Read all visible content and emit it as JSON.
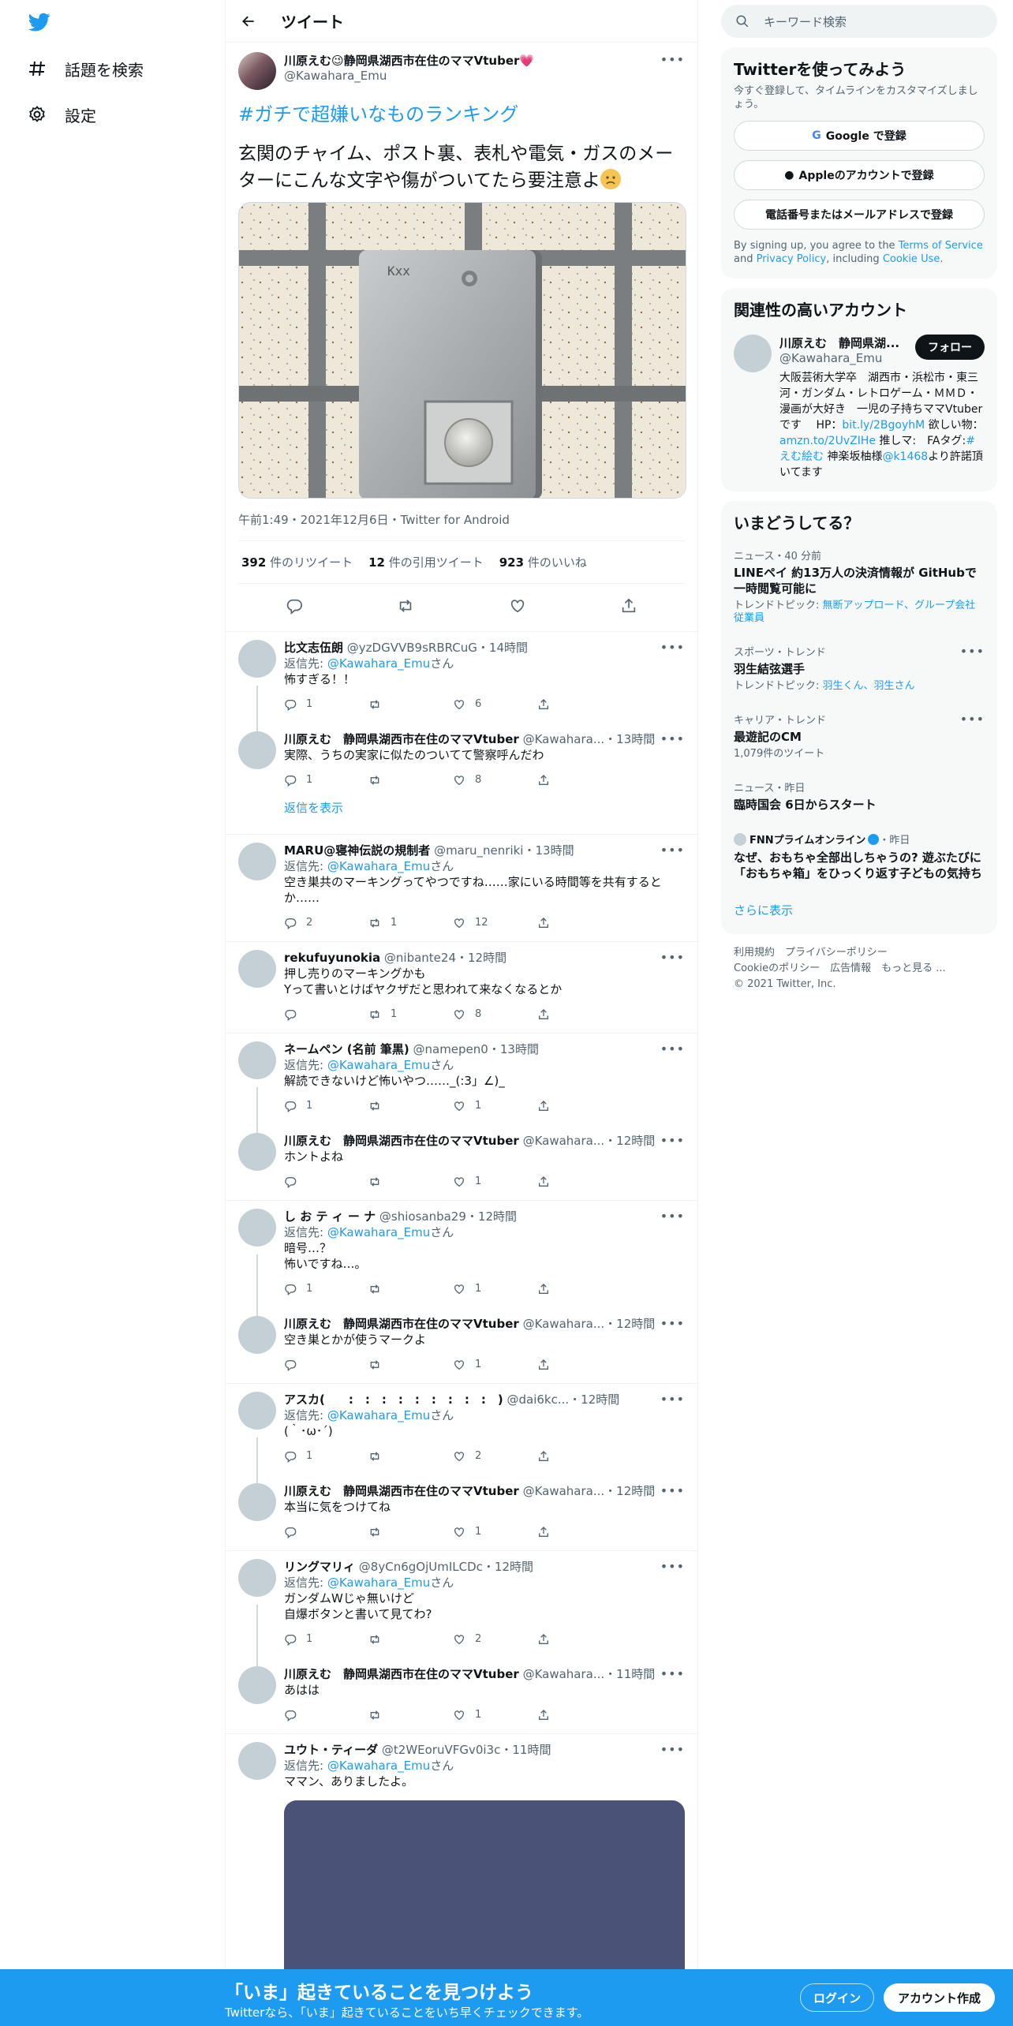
{
  "nav": {
    "explore_label": "話題を検索",
    "settings_label": "設定"
  },
  "header": {
    "title": "ツイート"
  },
  "focal": {
    "author_name": "川原えむ😉静岡県湖西市在住のママVtuber💗",
    "author_handle": "@Kawahara_Emu",
    "hashtag": "#ガチで超嫌いなものランキング",
    "text": "玄関のチャイム、ポスト裏、表札や電気・ガスのメーターにこんな文字や傷がついてたら要注意よ",
    "meta": "午前1:49・2021年12月6日・Twitter for Android",
    "image_text": "Kxx",
    "retweets": "392",
    "retweets_label": " 件のリツイート",
    "quotes": "12",
    "quotes_label": " 件の引用ツイート",
    "likes": "923",
    "likes_label": " 件のいいね"
  },
  "replies": [
    {
      "name": "比文志伍朗",
      "handle": "@yzDGVVB9sRBRCuG",
      "time": "14時間",
      "reply_to": "@Kawahara_Emu",
      "text": "怖すぎる！！",
      "replies": "1",
      "retweets": "",
      "likes": "6"
    },
    {
      "name": "川原えむ　静岡県湖西市在住のママVtuber",
      "handle": "@Kawahara...",
      "time": "13時間",
      "reply_to": "",
      "text": "実際、うちの実家に似たのついてて警察呼んだわ",
      "replies": "1",
      "retweets": "",
      "likes": "8"
    },
    {
      "name": "MARU@寝神伝説の規制者",
      "handle": "@maru_nenriki",
      "time": "13時間",
      "reply_to": "@Kawahara_Emu",
      "text": "空き巣共のマーキングってやつですね……家にいる時間等を共有するとか……",
      "replies": "2",
      "retweets": "1",
      "likes": "12"
    },
    {
      "name": "rekufuyunokia",
      "handle": "@nibante24",
      "time": "12時間",
      "reply_to": "",
      "text": "押し売りのマーキングかも\nYって書いとけばヤクザだと思われて来なくなるとか",
      "replies": "",
      "retweets": "1",
      "likes": "8"
    },
    {
      "name": "ネームペン (名前 筆黒)",
      "handle": "@namepen0",
      "time": "13時間",
      "reply_to": "@Kawahara_Emu",
      "text": "解読できないけど怖いやつ……_(:3」∠)_",
      "replies": "1",
      "retweets": "",
      "likes": "1"
    },
    {
      "name": "川原えむ　静岡県湖西市在住のママVtuber",
      "handle": "@Kawahara...",
      "time": "12時間",
      "reply_to": "",
      "text": "ホントよね",
      "replies": "",
      "retweets": "",
      "likes": "1"
    },
    {
      "name": "し お テ ィ ー ナ",
      "handle": "@shiosanba29",
      "time": "12時間",
      "reply_to": "@Kawahara_Emu",
      "text": "暗号…？\n怖いですね…。",
      "replies": "1",
      "retweets": "",
      "likes": "1"
    },
    {
      "name": "川原えむ　静岡県湖西市在住のママVtuber",
      "handle": "@Kawahara...",
      "time": "12時間",
      "reply_to": "",
      "text": "空き巣とかが使うマークよ",
      "replies": "",
      "retweets": "",
      "likes": "1"
    },
    {
      "name": "アスカ(　　:　:　:　:　:　:　:　:　:　)",
      "handle": "@dai6kc...",
      "time": "12時間",
      "reply_to": "@Kawahara_Emu",
      "text": "(｀･ω･´)",
      "replies": "1",
      "retweets": "",
      "likes": "2"
    },
    {
      "name": "川原えむ　静岡県湖西市在住のママVtuber",
      "handle": "@Kawahara...",
      "time": "12時間",
      "reply_to": "",
      "text": "本当に気をつけてね",
      "replies": "",
      "retweets": "",
      "likes": "1"
    },
    {
      "name": "リングマリィ",
      "handle": "@8yCn6gOjUmILCDc",
      "time": "12時間",
      "reply_to": "@Kawahara_Emu",
      "text": "ガンダムWじゃ無いけど\n自爆ボタンと書いて見てわ?",
      "replies": "1",
      "retweets": "",
      "likes": "2"
    },
    {
      "name": "川原えむ　静岡県湖西市在住のママVtuber",
      "handle": "@Kawahara...",
      "time": "11時間",
      "reply_to": "",
      "text": "あはは",
      "replies": "",
      "retweets": "",
      "likes": "1"
    },
    {
      "name": "ユウト・ティーダ",
      "handle": "@t2WEoruVFGv0i3c",
      "time": "11時間",
      "reply_to": "@Kawahara_Emu",
      "text": "ママン、ありましたよ。",
      "replies": "",
      "retweets": "",
      "likes": ""
    }
  ],
  "common": {
    "reply_prefix": "返信先: ",
    "reply_suffix": "さん",
    "show_replies": "返信を表示"
  },
  "search": {
    "placeholder": "キーワード検索"
  },
  "signup": {
    "title": "Twitterを使ってみよう",
    "subtitle": "今すぐ登録して、タイムラインをカスタマイズしましょう。",
    "google": "Google で登録",
    "apple": "Appleのアカウントで登録",
    "phone": "電話番号またはメールアドレスで登録",
    "terms_a": "By signing up, you agree to the ",
    "terms_link1": "Terms of Service",
    "terms_b": " and ",
    "terms_link2": "Privacy Policy",
    "terms_c": ", including ",
    "terms_link3": "Cookie Use",
    "terms_d": "."
  },
  "related": {
    "title": "関連性の高いアカウント",
    "name": "川原えむ　静岡県湖...",
    "handle": "@Kawahara_Emu",
    "follow": "フォロー",
    "bio_a": "大阪芸術大学卒　湖西市・浜松市・東三河・ガンダム・レトロゲーム・ＭＭＤ・漫画が大好き　一児の子持ちママVtuberです　 HP：",
    "bio_link1": "bit.ly/2BgoyhM",
    "bio_b": " 欲しい物：",
    "bio_link2": "amzn.to/2UvZIHe",
    "bio_c": " 推しマ:　FAタグ:",
    "bio_link3": "#えむ絵む",
    "bio_d": " 神楽坂柚様",
    "bio_link4": "@k1468",
    "bio_e": "より許諾頂いてます"
  },
  "trends": {
    "title": "いまどうしてる？",
    "items": [
      {
        "meta": "ニュース・40 分前",
        "title": "LINEペイ 約13万人の決済情報が GitHubで一時閲覧可能に",
        "desc_a": "トレンドトピック: ",
        "desc_b": "無断アップロード、グループ会社従業員"
      },
      {
        "meta": "スポーツ・トレンド",
        "title": "羽生結弦選手",
        "desc_a": "トレンドトピック: ",
        "desc_b": "羽生くん、羽生さん"
      },
      {
        "meta": "キャリア・トレンド",
        "title": "最遊記のCM",
        "desc_a": "1,079件のツイート",
        "desc_b": ""
      },
      {
        "meta": "ニュース・昨日",
        "title": "臨時国会 6日からスタート",
        "desc_a": "",
        "desc_b": ""
      }
    ],
    "news_source": "FNNプライムオンライン",
    "news_time": "・昨日",
    "news_title": "なぜ、おもちゃ全部出しちゃうの? 遊ぶたびに「おもちゃ箱」をひっくり返す子どもの気持ち",
    "show_more": "さらに表示"
  },
  "footer": {
    "line1": "利用規約　プライバシーポリシー",
    "line2": "Cookieのポリシー　広告情報　もっと見る ...",
    "line3": "© 2021 Twitter, Inc."
  },
  "bottombar": {
    "title": "「いま」起きていることを見つけよう",
    "subtitle": "Twitterなら、「いま」起きていることをいち早くチェックできます。",
    "login": "ログイン",
    "signup": "アカウント作成"
  },
  "colors": {
    "accent": "#1d9bf0",
    "text": "#0f1419",
    "muted": "#536471",
    "border": "#eff3f4",
    "panel": "#f7f9f9"
  }
}
